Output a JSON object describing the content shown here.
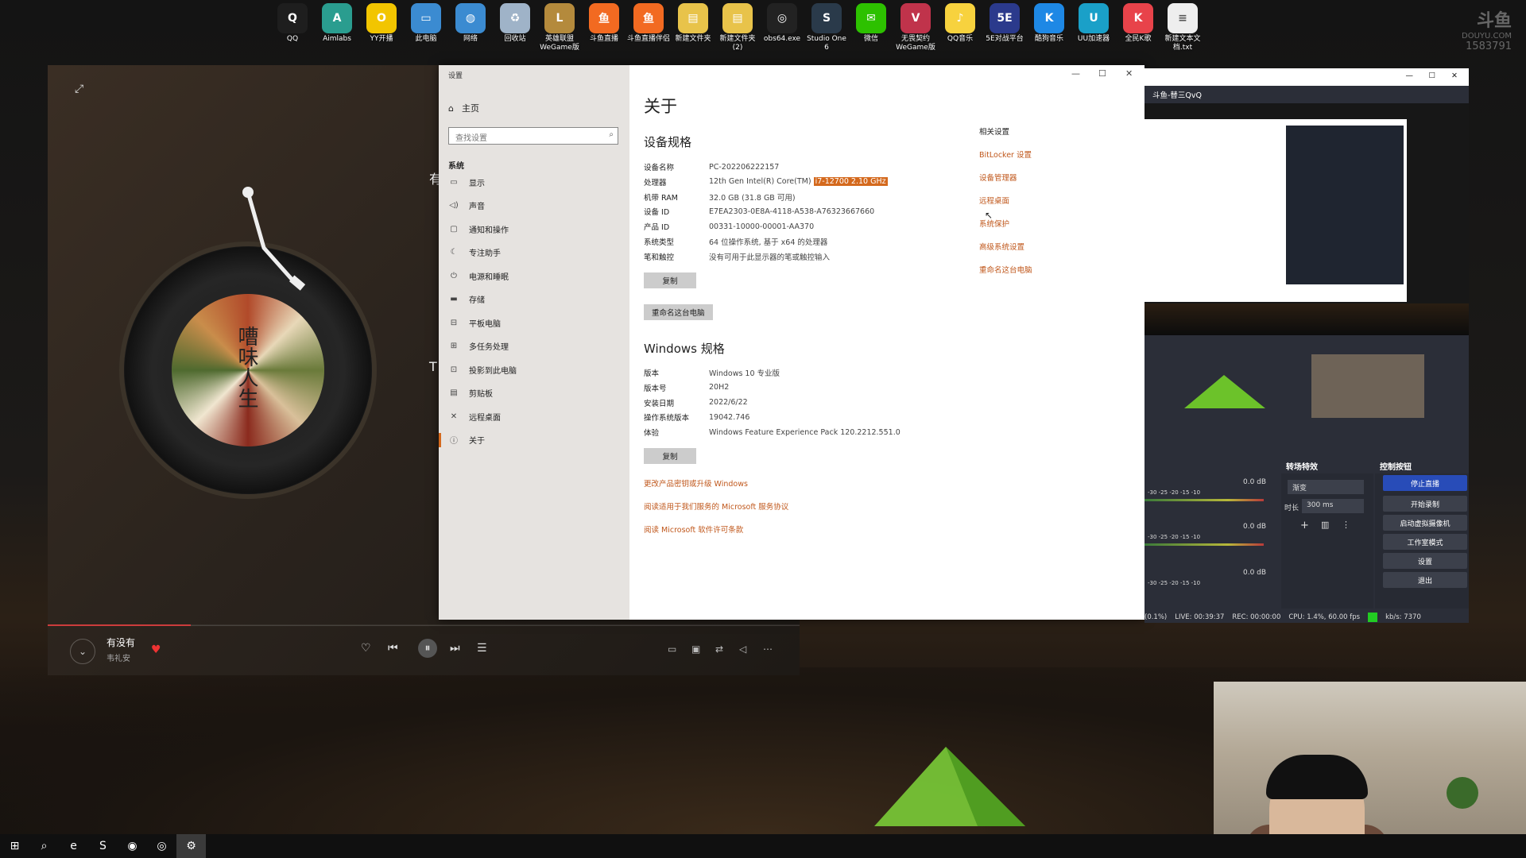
{
  "desktop": {
    "icons": [
      {
        "label": "QQ",
        "color": "#1e1e1e",
        "glyph": "Q"
      },
      {
        "label": "Aimlabs",
        "color": "#2a9d8f",
        "glyph": "A"
      },
      {
        "label": "YY开播",
        "color": "#f2c500",
        "glyph": "O"
      },
      {
        "label": "此电脑",
        "color": "#3b8bd1",
        "glyph": "▭"
      },
      {
        "label": "网络",
        "color": "#3b8bd1",
        "glyph": "◍"
      },
      {
        "label": "回收站",
        "color": "#9fb3c8",
        "glyph": "♻"
      },
      {
        "label": "英雄联盟 WeGame版",
        "color": "#b48a3c",
        "glyph": "L"
      },
      {
        "label": "斗鱼直播",
        "color": "#f26a21",
        "glyph": "鱼"
      },
      {
        "label": "斗鱼直播伴侣",
        "color": "#f26a21",
        "glyph": "鱼"
      },
      {
        "label": "新建文件夹",
        "color": "#e8c34a",
        "glyph": "▤"
      },
      {
        "label": "新建文件夹 (2)",
        "color": "#e8c34a",
        "glyph": "▤"
      },
      {
        "label": "obs64.exe",
        "color": "#222222",
        "glyph": "◎"
      },
      {
        "label": "Studio One 6",
        "color": "#2a3a4a",
        "glyph": "S"
      },
      {
        "label": "微信",
        "color": "#2dc100",
        "glyph": "✉"
      },
      {
        "label": "无畏契约 WeGame版",
        "color": "#c0334b",
        "glyph": "V"
      },
      {
        "label": "QQ音乐",
        "color": "#f7d23e",
        "glyph": "♪"
      },
      {
        "label": "5E对战平台",
        "color": "#2b3a8c",
        "glyph": "5E"
      },
      {
        "label": "酷狗音乐",
        "color": "#1e88e5",
        "glyph": "K"
      },
      {
        "label": "UU加速器",
        "color": "#1aa0c8",
        "glyph": "U"
      },
      {
        "label": "全民K歌",
        "color": "#e8434a",
        "glyph": "K"
      },
      {
        "label": "新建文本文档.txt",
        "color": "#eeeeee",
        "glyph": "≡"
      }
    ],
    "watermark": {
      "brand": "斗鱼",
      "sub": "DOUYU.COM",
      "room": "1583791"
    }
  },
  "music": {
    "album_text": "嘈味人生",
    "side_title": "有",
    "side_initial": "T",
    "song": "有没有",
    "artist": "韦礼安",
    "progress": 0.19,
    "controls": {
      "prev": "⏮",
      "pause": "⏸",
      "next": "⏭",
      "list": "☰",
      "like": "♡"
    }
  },
  "settings": {
    "window_title": "设置",
    "home": "主页",
    "search_placeholder": "查找设置",
    "section": "系统",
    "nav": [
      {
        "icon": "▭",
        "label": "显示"
      },
      {
        "icon": "◁)",
        "label": "声音"
      },
      {
        "icon": "▢",
        "label": "通知和操作"
      },
      {
        "icon": "☾",
        "label": "专注助手"
      },
      {
        "icon": "⏻",
        "label": "电源和睡眠"
      },
      {
        "icon": "▬",
        "label": "存储"
      },
      {
        "icon": "⊟",
        "label": "平板电脑"
      },
      {
        "icon": "⊞",
        "label": "多任务处理"
      },
      {
        "icon": "⊡",
        "label": "投影到此电脑"
      },
      {
        "icon": "▤",
        "label": "剪贴板"
      },
      {
        "icon": "✕",
        "label": "远程桌面"
      },
      {
        "icon": "ⓘ",
        "label": "关于"
      }
    ],
    "page_title": "关于",
    "device_heading": "设备规格",
    "device_specs": [
      {
        "k": "设备名称",
        "v": "PC-202206222157"
      },
      {
        "k": "处理器",
        "v": "12th Gen Intel(R) Core(TM)",
        "hl": "i7-12700   2.10 GHz"
      },
      {
        "k": "机带 RAM",
        "v": "32.0 GB (31.8 GB 可用)"
      },
      {
        "k": "设备 ID",
        "v": "E7EA2303-0E8A-4118-A538-A76323667660"
      },
      {
        "k": "产品 ID",
        "v": "00331-10000-00001-AA370"
      },
      {
        "k": "系统类型",
        "v": "64 位操作系统, 基于 x64 的处理器"
      },
      {
        "k": "笔和触控",
        "v": "没有可用于此显示器的笔或触控输入"
      }
    ],
    "copy_label": "复制",
    "rename_label": "重命名这台电脑",
    "windows_heading": "Windows 规格",
    "windows_specs": [
      {
        "k": "版本",
        "v": "Windows 10 专业版"
      },
      {
        "k": "版本号",
        "v": "20H2"
      },
      {
        "k": "安装日期",
        "v": "2022/6/22"
      },
      {
        "k": "操作系统版本",
        "v": "19042.746"
      },
      {
        "k": "体验",
        "v": "Windows Feature Experience Pack 120.2212.551.0"
      }
    ],
    "copy2_label": "复制",
    "links": [
      "更改产品密钥或升级 Windows",
      "阅读适用于我们服务的 Microsoft 服务协议",
      "阅读 Microsoft 软件许可条款"
    ],
    "related_title": "相关设置",
    "related_links": [
      "BitLocker 设置",
      "设备管理器",
      "远程桌面",
      "系统保护",
      "高级系统设置",
      "重命名这台电脑"
    ],
    "accent": "#d4691d"
  },
  "obs": {
    "title": "斗鱼-替三QvQ",
    "docks": {
      "transitions": "转场特效",
      "controls": "控制按钮"
    },
    "transition": {
      "value": "渐变",
      "duration_label": "时长",
      "duration": "300 ms"
    },
    "buttons": [
      "停止直播",
      "开始录制",
      "启动虚拟摄像机",
      "工作室模式",
      "设置",
      "退出"
    ],
    "db_values": [
      "0.0 dB",
      "0.0 dB",
      "0.0 dB"
    ],
    "meter_ticks": "-30  -25  -20  -15  -10",
    "status": {
      "drop": "(0.1%)",
      "live": "LIVE: 00:39:37",
      "rec": "REC: 00:00:00",
      "cpu": "CPU: 1.4%, 60.00 fps",
      "kbps": "kb/s: 7370"
    }
  },
  "taskbar": {
    "items": [
      {
        "name": "start-icon",
        "glyph": "⊞"
      },
      {
        "name": "search-icon",
        "glyph": "⌕"
      },
      {
        "name": "edge-icon",
        "glyph": "e"
      },
      {
        "name": "studio-one-icon",
        "glyph": "S"
      },
      {
        "name": "steam-icon",
        "glyph": "◉"
      },
      {
        "name": "netease-music-icon",
        "glyph": "◎"
      },
      {
        "name": "settings-gear-icon",
        "glyph": "⚙"
      }
    ]
  }
}
